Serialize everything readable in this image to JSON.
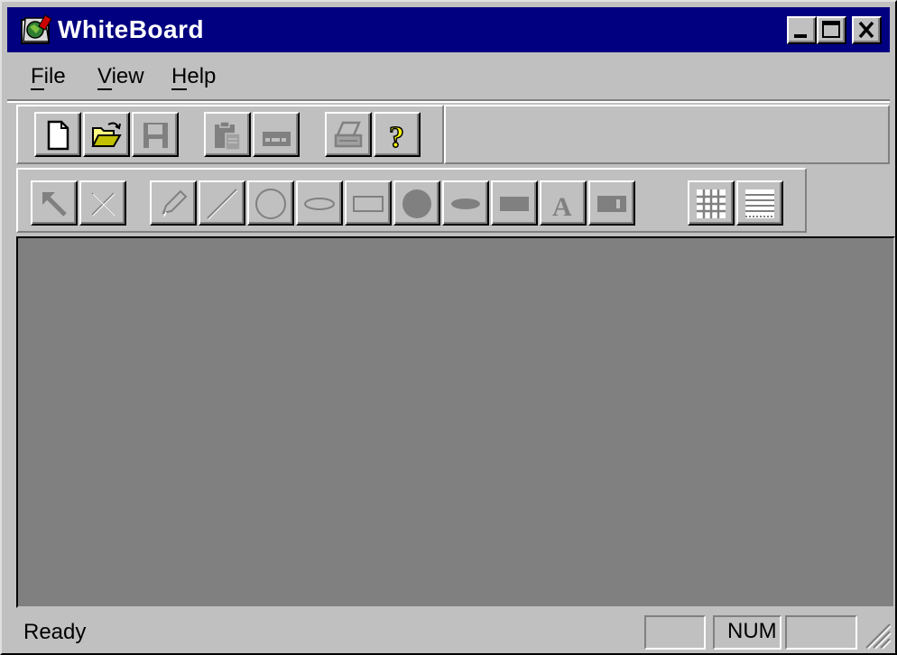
{
  "window": {
    "title": "WhiteBoard"
  },
  "title_buttons": [
    {
      "name": "minimize-button",
      "icon": "minimize-icon"
    },
    {
      "name": "maximize-button",
      "icon": "maximize-icon"
    },
    {
      "name": "close-button",
      "icon": "close-icon"
    }
  ],
  "menu": {
    "file": {
      "first": "F",
      "rest": "ile"
    },
    "view": {
      "first": "V",
      "rest": "iew"
    },
    "help": {
      "first": "H",
      "rest": "elp"
    }
  },
  "toolbar_main": [
    {
      "name": "new-button",
      "icon": "new-document-icon",
      "enabled": true
    },
    {
      "name": "open-button",
      "icon": "open-folder-icon",
      "enabled": true
    },
    {
      "name": "save-button",
      "icon": "save-disk-icon",
      "enabled": false
    },
    {
      "name": "paste-button",
      "icon": "paste-icon",
      "enabled": false
    },
    {
      "name": "paste-special-button",
      "icon": "keyboard-icon",
      "enabled": false
    },
    {
      "name": "print-button",
      "icon": "printer-icon",
      "enabled": false
    },
    {
      "name": "help-button",
      "icon": "question-mark-icon",
      "enabled": true
    }
  ],
  "toolbar_draw": [
    {
      "name": "select-tool-button",
      "icon": "arrow-pointer-icon"
    },
    {
      "name": "delete-tool-button",
      "icon": "delete-x-icon"
    },
    {
      "name": "pen-tool-button",
      "icon": "pencil-icon"
    },
    {
      "name": "line-tool-button",
      "icon": "line-icon"
    },
    {
      "name": "circle-tool-button",
      "icon": "circle-outline-icon"
    },
    {
      "name": "ellipse-tool-button",
      "icon": "ellipse-outline-icon"
    },
    {
      "name": "rectangle-tool-button",
      "icon": "rectangle-outline-icon"
    },
    {
      "name": "filled-circle-tool-button",
      "icon": "filled-circle-icon"
    },
    {
      "name": "filled-ellipse-tool-button",
      "icon": "filled-ellipse-icon"
    },
    {
      "name": "filled-rectangle-tool-button",
      "icon": "filled-rectangle-icon"
    },
    {
      "name": "text-tool-button",
      "icon": "text-a-icon"
    },
    {
      "name": "textbox-tool-button",
      "icon": "textbox-icon"
    },
    {
      "name": "grid-button",
      "icon": "grid-icon"
    },
    {
      "name": "lines-button",
      "icon": "ruled-lines-icon"
    }
  ],
  "colors": {
    "titlebar": "#000080",
    "face": "#c0c0c0",
    "canvas": "#808080"
  },
  "status": {
    "text": "Ready",
    "panes": [
      "",
      "NUM",
      ""
    ]
  }
}
